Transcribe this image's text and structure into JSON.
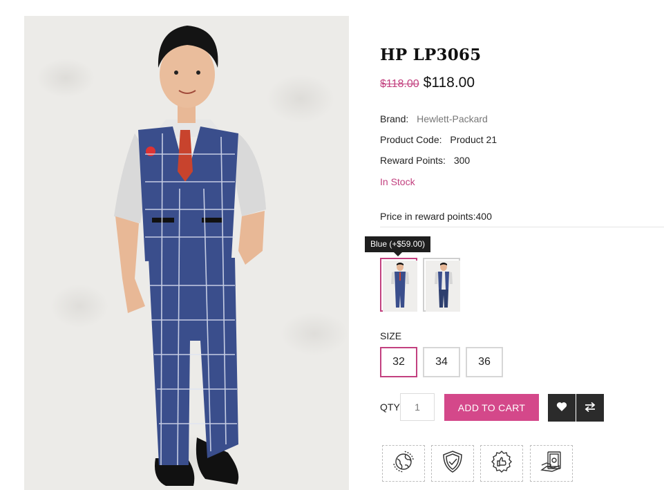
{
  "product": {
    "title": "HP LP3065",
    "old_price": "$118.00",
    "new_price": "$118.00",
    "brand_label": "Brand:",
    "brand_value": "Hewlett-Packard",
    "code_label": "Product Code:",
    "code_value": "Product 21",
    "reward_label": "Reward Points:",
    "reward_value": "300",
    "stock": "In Stock",
    "reward_price": "Price in reward points:400",
    "image_icon": "boy-in-blue-checked-suit-photo"
  },
  "options": {
    "tooltip": "Blue (+$59.00)",
    "swatches": [
      {
        "name": "blue-swatch",
        "selected": true
      },
      {
        "name": "alt-swatch",
        "selected": false
      }
    ],
    "size_label": "SIZE",
    "sizes": [
      "32",
      "34",
      "36"
    ],
    "selected_size": "32"
  },
  "cart": {
    "qty_label": "QTY",
    "qty_value": "1",
    "add_to_cart": "ADD TO CART",
    "wishlist_icon": "heart-icon",
    "compare_icon": "compare-arrows-icon"
  },
  "features": [
    "worldwide-shipping-icon",
    "secure-shield-icon",
    "quality-badge-icon",
    "cash-payment-icon"
  ],
  "colors": {
    "accent": "#d4488a",
    "accent_text": "#c2407f",
    "dark_button": "#2b2b2b",
    "suit_blue": "#3a4e8c"
  }
}
